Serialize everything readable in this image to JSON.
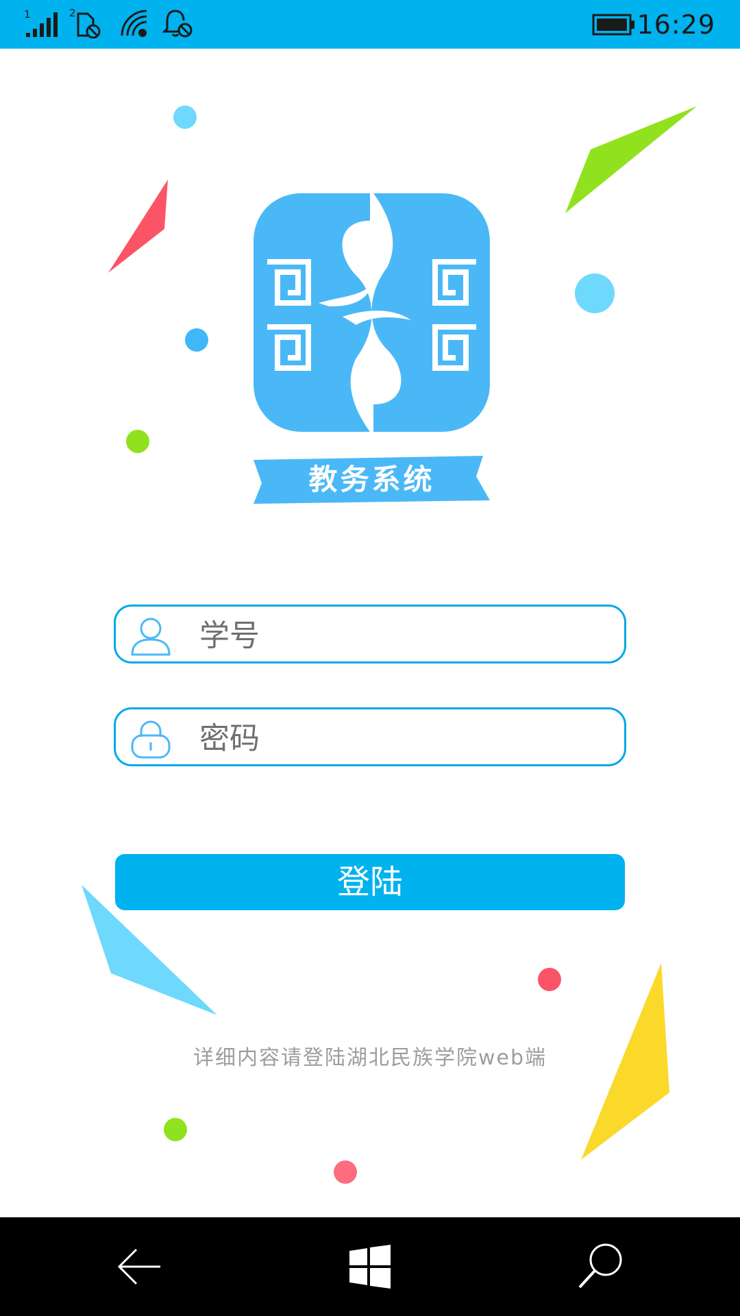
{
  "status_bar": {
    "sim1_label": "1",
    "sim2_label": "2",
    "time": "16:29",
    "icons": [
      "signal-icon",
      "sim-blocked-icon",
      "wifi-icon",
      "alarm-off-icon",
      "battery-icon"
    ],
    "background": "#00b2ee"
  },
  "logo": {
    "banner_text": "教务系统",
    "color": "#4ab8f7"
  },
  "login_form": {
    "student_id": {
      "value": "",
      "placeholder": "学号",
      "icon": "user-icon"
    },
    "password": {
      "value": "",
      "placeholder": "密码",
      "icon": "lock-icon"
    },
    "submit_label": "登陆",
    "accent": "#00b2ee"
  },
  "footer": {
    "note": "详细内容请登陆湖北民族学院web端"
  },
  "nav_bar": {
    "icons": [
      "back-arrow-icon",
      "windows-start-icon",
      "search-icon"
    ],
    "background": "#000000"
  }
}
